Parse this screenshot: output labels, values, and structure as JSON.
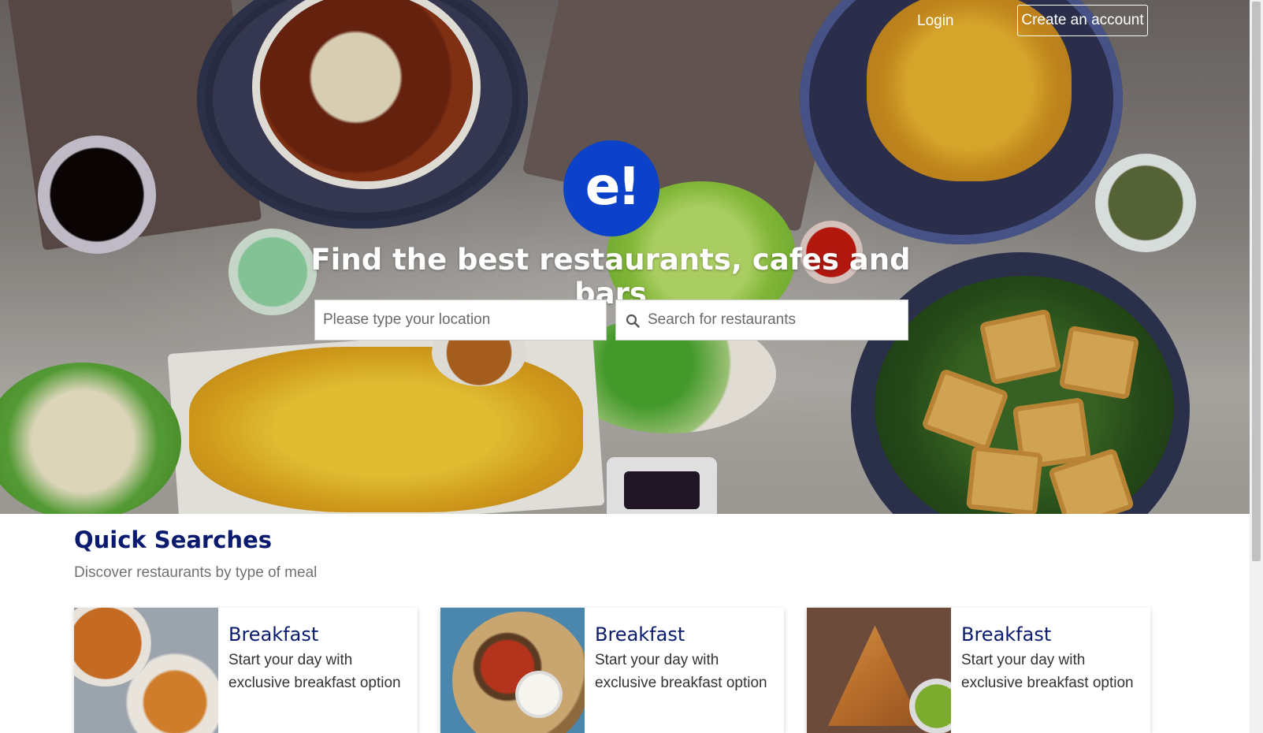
{
  "header": {
    "login_label": "Login",
    "create_account_label": "Create an account"
  },
  "hero": {
    "logo_text": "e!",
    "headline": "Find the best restaurants, cafes and bars",
    "location_placeholder": "Please type your location",
    "restaurant_placeholder": "Search for restaurants"
  },
  "quick_searches": {
    "title": "Quick Searches",
    "subtitle": "Discover restaurants by type of meal",
    "cards": [
      {
        "title": "Breakfast",
        "description": "Start your day with exclusive breakfast option"
      },
      {
        "title": "Breakfast",
        "description": "Start your day with exclusive breakfast option"
      },
      {
        "title": "Breakfast",
        "description": "Start your day with exclusive breakfast option"
      }
    ]
  },
  "colors": {
    "brand_blue": "#0b42c9",
    "heading_navy": "#0a1a6f",
    "subtitle_gray": "#707070"
  }
}
